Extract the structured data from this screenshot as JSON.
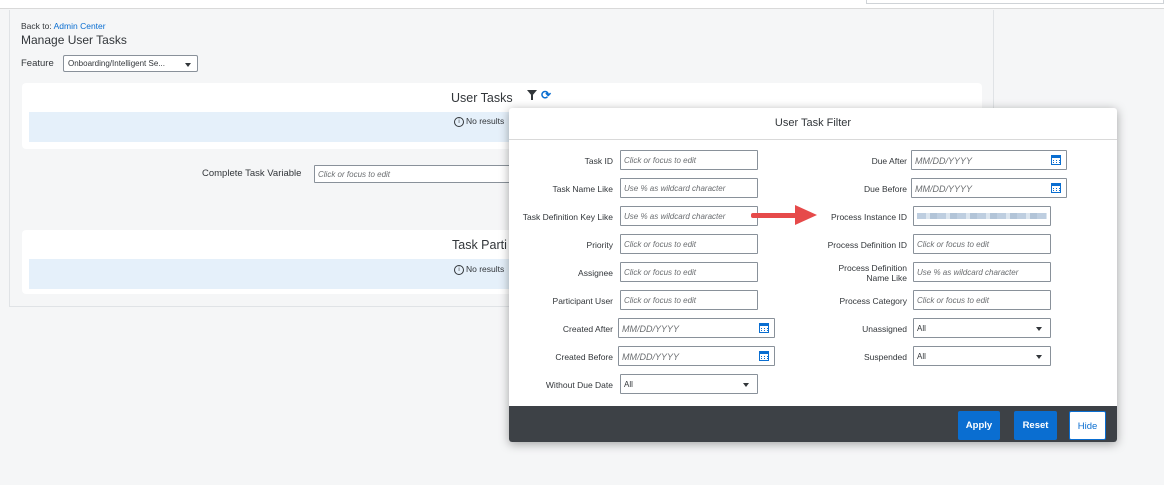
{
  "breadcrumb": {
    "prefix": "Back to:",
    "link": "Admin Center"
  },
  "page_title": "Manage User Tasks",
  "feature": {
    "label": "Feature",
    "value": "Onboarding/Intelligent Se..."
  },
  "user_tasks": {
    "title": "User Tasks",
    "no_results": "No results"
  },
  "complete_task_variable": {
    "label": "Complete Task Variable",
    "placeholder": "Click or focus to edit"
  },
  "task_participants": {
    "title": "Task Parti",
    "no_results": "No results"
  },
  "filter_dialog": {
    "title": "User Task Filter",
    "left_fields": [
      {
        "label": "Task ID",
        "placeholder": "Click or focus to edit"
      },
      {
        "label": "Task Name Like",
        "placeholder": "Use % as wildcard character"
      },
      {
        "label": "Task Definition Key Like",
        "placeholder": "Use % as wildcard character"
      },
      {
        "label": "Priority",
        "placeholder": "Click or focus to edit"
      },
      {
        "label": "Assignee",
        "placeholder": "Click or focus to edit"
      },
      {
        "label": "Participant User",
        "placeholder": "Click or focus to edit"
      },
      {
        "label": "Created After",
        "placeholder": "MM/DD/YYYY"
      },
      {
        "label": "Created Before",
        "placeholder": "MM/DD/YYYY"
      },
      {
        "label": "Without Due Date",
        "value": "All"
      }
    ],
    "right_fields": [
      {
        "label": "Due After",
        "placeholder": "MM/DD/YYYY"
      },
      {
        "label": "Due Before",
        "placeholder": "MM/DD/YYYY"
      },
      {
        "label": "Process Instance ID",
        "value": ""
      },
      {
        "label": "Process Definition ID",
        "placeholder": "Click or focus to edit"
      },
      {
        "label_line1": "Process Definition",
        "label_line2": "Name Like",
        "placeholder": "Use % as wildcard character"
      },
      {
        "label": "Process Category",
        "placeholder": "Click or focus to edit"
      },
      {
        "label": "Unassigned",
        "value": "All"
      },
      {
        "label": "Suspended",
        "value": "All"
      }
    ],
    "buttons": {
      "apply": "Apply",
      "reset": "Reset",
      "hide": "Hide"
    }
  },
  "colors": {
    "accent": "#0a6ed1",
    "footer": "#3d4146",
    "annotation_arrow": "#e64a4a",
    "info_bar": "#e5f0fa"
  },
  "icons": [
    "filter-icon",
    "refresh-icon",
    "info-icon",
    "calendar-icon",
    "chevron-down-icon",
    "arrow-annotation"
  ]
}
